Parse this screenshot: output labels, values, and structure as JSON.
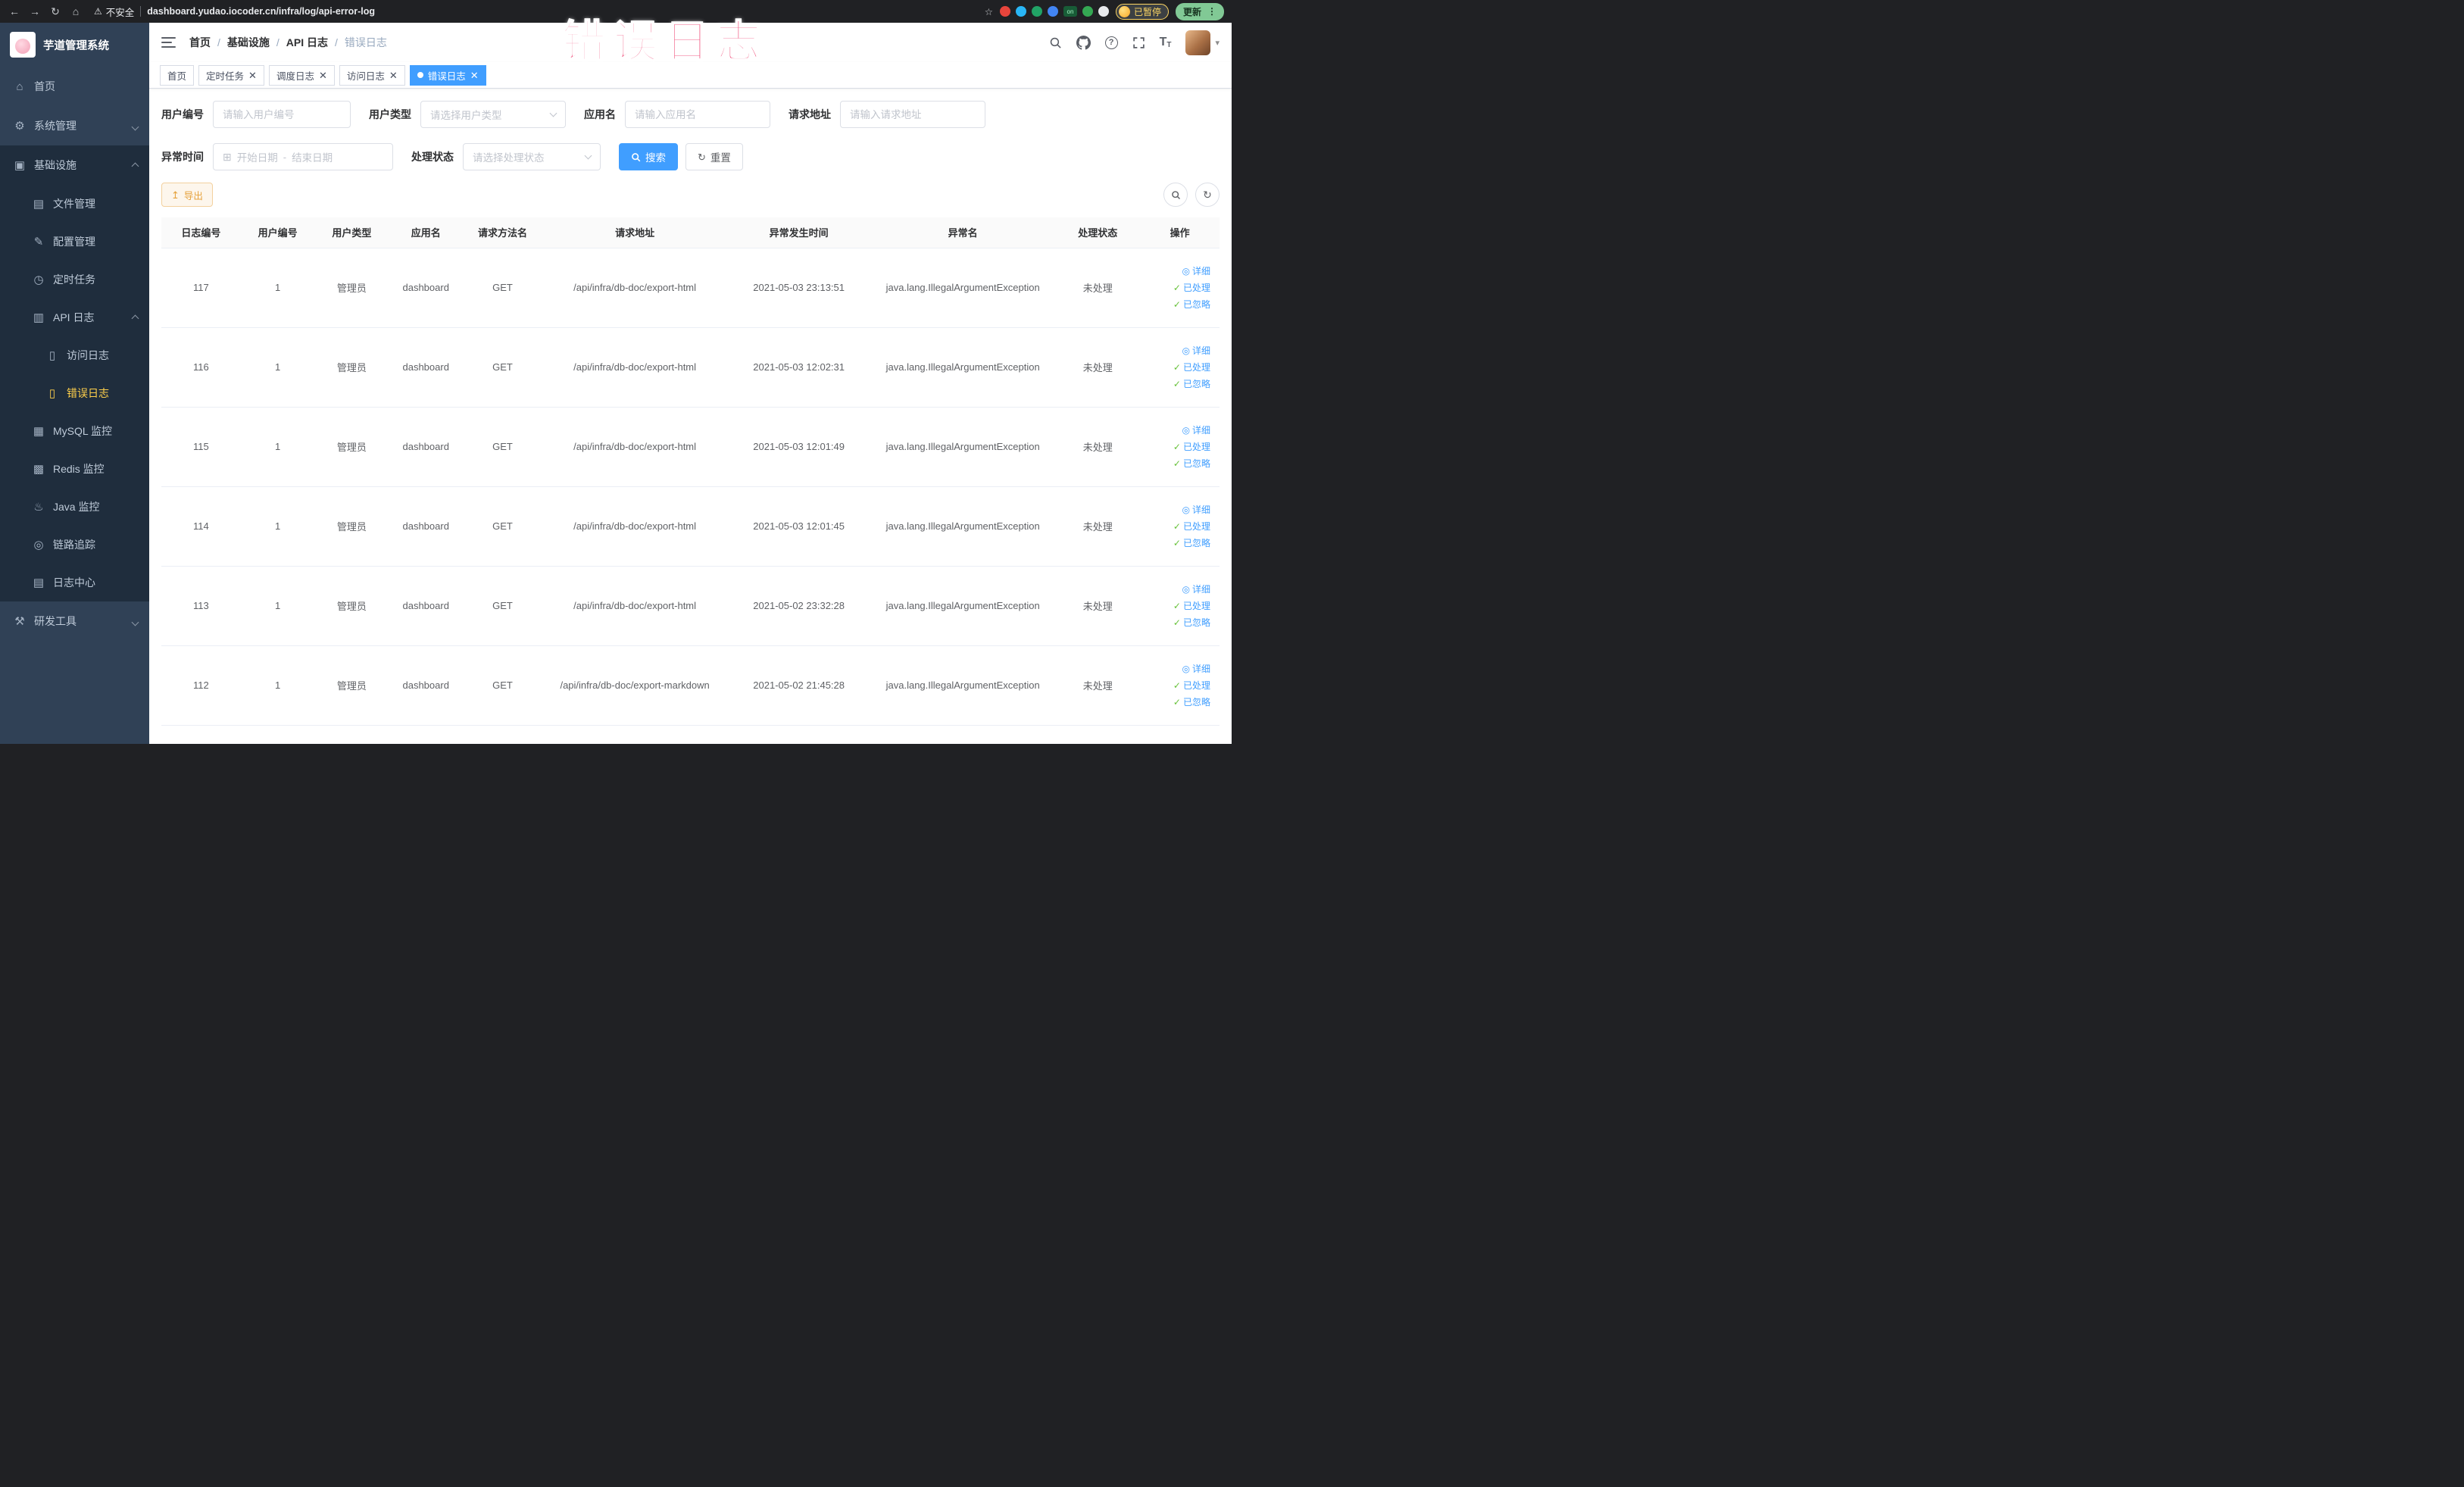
{
  "colors": {
    "primary": "#409eff",
    "warning": "#e6a23c",
    "success": "#67c23a",
    "sidebar_bg": "#304156",
    "submenu_bg": "#1f2d3d",
    "menu_active": "#ffd04b",
    "annotation_pink": "#f0517c"
  },
  "icons": {
    "arrow_left": "←",
    "arrow_right": "→",
    "refresh": "↻",
    "home": "⌂",
    "warning": "⚠",
    "star": "☆",
    "kebab": "⋮",
    "on_badge": "on",
    "gear": "⚙",
    "monitor": "▣",
    "folder": "▤",
    "edit": "✎",
    "timer": "◷",
    "api": "▥",
    "doc": "▯",
    "grid": "▦",
    "hash": "▩",
    "java": "♨",
    "trace": "◎",
    "logdoc": "▤",
    "tools": "⚒",
    "calendar": "⊞",
    "close": "✕",
    "check": "✓",
    "eye": "◎",
    "caret_down": "▾",
    "export": "↥",
    "question": "?",
    "font": "T"
  },
  "browser": {
    "security_label": "不安全",
    "url": "dashboard.yudao.iocoder.cn/infra/log/api-error-log",
    "profile_badge": "已暂停",
    "update_button": "更新"
  },
  "annotation": {
    "text": "错误日志"
  },
  "sidebar": {
    "logo_title": "芋道管理系统",
    "home": "首页",
    "system_mgmt": "系统管理",
    "infrastructure": "基础设施",
    "file_mgmt": "文件管理",
    "config_mgmt": "配置管理",
    "scheduled_jobs": "定时任务",
    "api_log": "API 日志",
    "access_log": "访问日志",
    "error_log": "错误日志",
    "mysql_monitor": "MySQL 监控",
    "redis_monitor": "Redis 监控",
    "java_monitor": "Java 监控",
    "trace": "链路追踪",
    "log_center": "日志中心",
    "dev_tools": "研发工具"
  },
  "breadcrumb": {
    "separator": "/",
    "items": [
      "首页",
      "基础设施",
      "API 日志",
      "错误日志"
    ]
  },
  "tabs": [
    {
      "label": "首页",
      "closable": false,
      "active": false
    },
    {
      "label": "定时任务",
      "closable": true,
      "active": false
    },
    {
      "label": "调度日志",
      "closable": true,
      "active": false
    },
    {
      "label": "访问日志",
      "closable": true,
      "active": false
    },
    {
      "label": "错误日志",
      "closable": true,
      "active": true
    }
  ],
  "filters": {
    "user_id_label": "用户编号",
    "user_id_placeholder": "请输入用户编号",
    "user_type_label": "用户类型",
    "user_type_placeholder": "请选择用户类型",
    "app_name_label": "应用名",
    "app_name_placeholder": "请输入应用名",
    "request_url_label": "请求地址",
    "request_url_placeholder": "请输入请求地址",
    "exception_time_label": "异常时间",
    "date_start_placeholder": "开始日期",
    "date_separator": "-",
    "date_end_placeholder": "结束日期",
    "process_status_label": "处理状态",
    "process_status_placeholder": "请选择处理状态",
    "search_button": "搜索",
    "reset_button": "重置"
  },
  "toolbar": {
    "export_button": "导出"
  },
  "table": {
    "columns": [
      "日志编号",
      "用户编号",
      "用户类型",
      "应用名",
      "请求方法名",
      "请求地址",
      "异常发生时间",
      "异常名",
      "处理状态",
      "操作"
    ],
    "actions": {
      "detail": "详细",
      "processed": "已处理",
      "ignored": "已忽略"
    },
    "rows": [
      {
        "log_id": "117",
        "user_id": "1",
        "user_type": "管理员",
        "app_name": "dashboard",
        "method": "GET",
        "request_url": "/api/infra/db-doc/export-html",
        "time": "2021-05-03 23:13:51",
        "exception": "java.lang.IllegalArgumentException",
        "status": "未处理"
      },
      {
        "log_id": "116",
        "user_id": "1",
        "user_type": "管理员",
        "app_name": "dashboard",
        "method": "GET",
        "request_url": "/api/infra/db-doc/export-html",
        "time": "2021-05-03 12:02:31",
        "exception": "java.lang.IllegalArgumentException",
        "status": "未处理"
      },
      {
        "log_id": "115",
        "user_id": "1",
        "user_type": "管理员",
        "app_name": "dashboard",
        "method": "GET",
        "request_url": "/api/infra/db-doc/export-html",
        "time": "2021-05-03 12:01:49",
        "exception": "java.lang.IllegalArgumentException",
        "status": "未处理"
      },
      {
        "log_id": "114",
        "user_id": "1",
        "user_type": "管理员",
        "app_name": "dashboard",
        "method": "GET",
        "request_url": "/api/infra/db-doc/export-html",
        "time": "2021-05-03 12:01:45",
        "exception": "java.lang.IllegalArgumentException",
        "status": "未处理"
      },
      {
        "log_id": "113",
        "user_id": "1",
        "user_type": "管理员",
        "app_name": "dashboard",
        "method": "GET",
        "request_url": "/api/infra/db-doc/export-html",
        "time": "2021-05-02 23:32:28",
        "exception": "java.lang.IllegalArgumentException",
        "status": "未处理"
      },
      {
        "log_id": "112",
        "user_id": "1",
        "user_type": "管理员",
        "app_name": "dashboard",
        "method": "GET",
        "request_url": "/api/infra/db-doc/export-markdown",
        "time": "2021-05-02 21:45:28",
        "exception": "java.lang.IllegalArgumentException",
        "status": "未处理"
      }
    ]
  }
}
